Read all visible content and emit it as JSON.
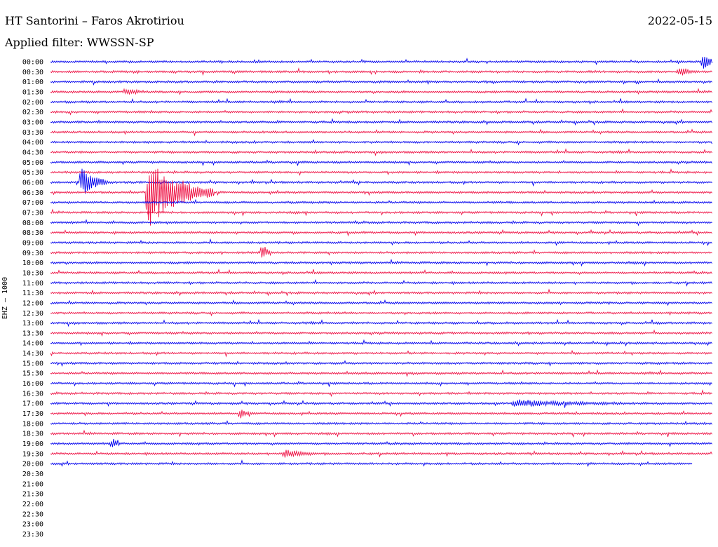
{
  "header": {
    "station": "HT Santorini – Faros Akrotiriou",
    "date": "2022-05-15",
    "filter": "Applied filter: WWSSN-SP",
    "channel": "EHZ – 1000"
  },
  "colors": {
    "even_trace": "#0000ee",
    "odd_trace": "#ee1144"
  },
  "chart_data": {
    "type": "line",
    "title": "HT Santorini – Faros Akrotiriou",
    "subtitle": "Applied filter: WWSSN-SP",
    "ylabel": "EHZ – 1000",
    "row_labels": [
      "00:00",
      "00:30",
      "01:00",
      "01:30",
      "02:00",
      "02:30",
      "03:00",
      "03:30",
      "04:00",
      "04:30",
      "05:00",
      "05:30",
      "06:00",
      "06:30",
      "07:00",
      "07:30",
      "08:00",
      "08:30",
      "09:00",
      "09:30",
      "10:00",
      "10:30",
      "11:00",
      "11:30",
      "12:00",
      "12:30",
      "13:00",
      "13:30",
      "14:00",
      "14:30",
      "15:00",
      "15:30",
      "16:00",
      "16:30",
      "17:00",
      "17:30",
      "18:00",
      "18:30",
      "19:00",
      "19:30",
      "20:00",
      "20:30",
      "21:00",
      "21:30",
      "22:00",
      "22:30",
      "23:00",
      "23:30"
    ],
    "rows_recorded": 41,
    "last_row_fraction": 0.97,
    "x_range_minutes": [
      0,
      30
    ],
    "events": [
      {
        "row": "00:00",
        "minute": 29.6,
        "amplitude": 1.0,
        "duration": 0.6
      },
      {
        "row": "00:30",
        "minute": 28.5,
        "amplitude": 0.6,
        "duration": 0.8
      },
      {
        "row": "01:30",
        "minute": 3.4,
        "amplitude": 0.4,
        "duration": 1.0
      },
      {
        "row": "06:00",
        "minute": 1.4,
        "amplitude": 2.0,
        "duration": 1.2
      },
      {
        "row": "06:30",
        "minute": 4.4,
        "amplitude": 4.2,
        "duration": 3.0
      },
      {
        "row": "09:30",
        "minute": 9.6,
        "amplitude": 1.1,
        "duration": 0.4
      },
      {
        "row": "17:00",
        "minute": 21.0,
        "amplitude": 0.4,
        "duration": 5.0
      },
      {
        "row": "17:30",
        "minute": 8.6,
        "amplitude": 0.6,
        "duration": 0.5
      },
      {
        "row": "19:00",
        "minute": 2.8,
        "amplitude": 0.6,
        "duration": 0.4
      },
      {
        "row": "19:30",
        "minute": 10.6,
        "amplitude": 0.5,
        "duration": 1.4
      }
    ],
    "grid": false,
    "legend": "none"
  }
}
